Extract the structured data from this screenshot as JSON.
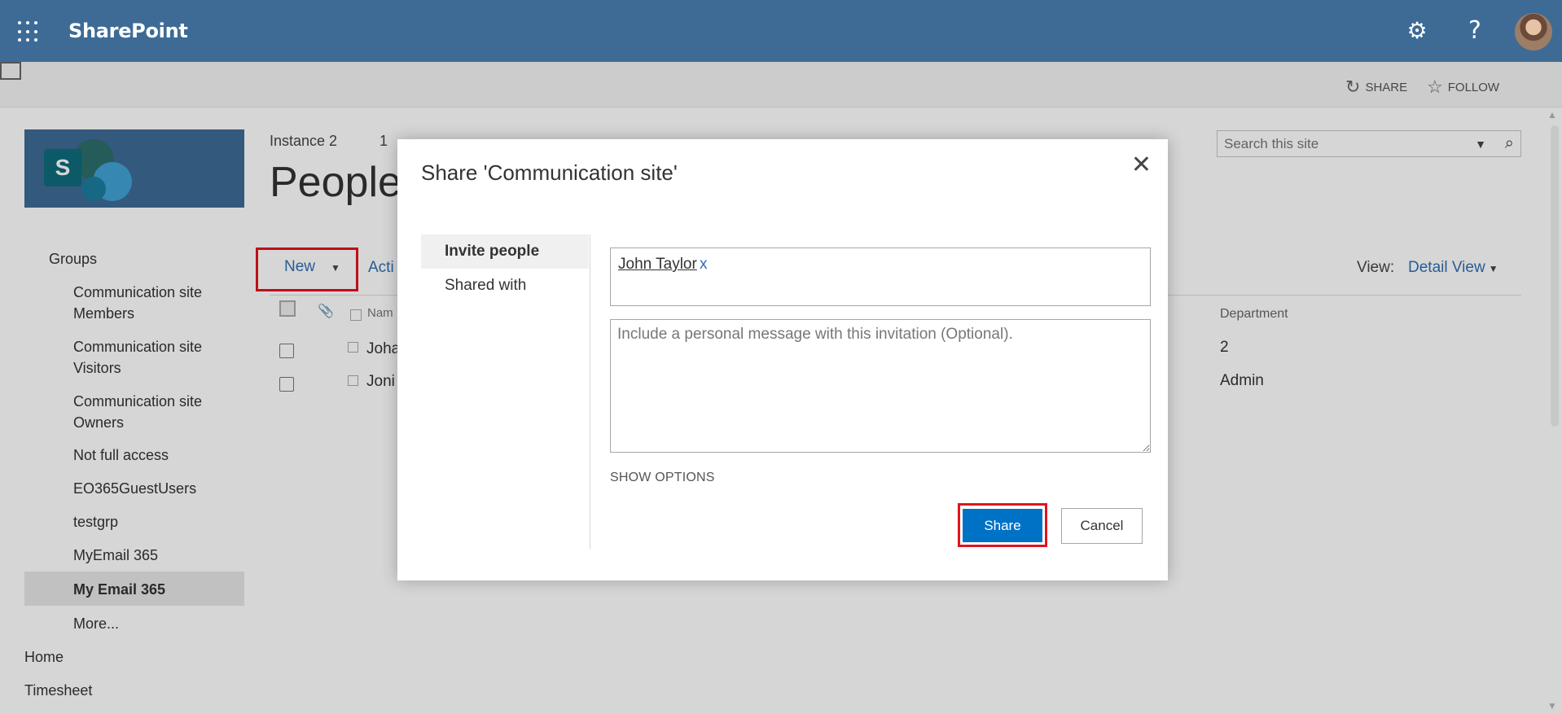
{
  "suite_bar": {
    "brand": "SharePoint",
    "icons": [
      "waffle-icon",
      "gear-icon",
      "help-icon",
      "avatar"
    ]
  },
  "ribbon": {
    "share_label": "SHARE",
    "follow_label": "FOLLOW"
  },
  "header": {
    "breadcrumb": "Instance 2",
    "breadcrumb_next": "1",
    "title": "People"
  },
  "search": {
    "placeholder": "Search this site"
  },
  "leftnav": {
    "groups_heading": "Groups",
    "items": [
      "Communication site Members",
      "Communication site Visitors",
      "Communication site Owners",
      "Not full access",
      "EO365GuestUsers",
      "testgrp",
      "MyEmail 365",
      "My Email 365",
      "More..."
    ],
    "selected": "My Email 365",
    "top_links": [
      "Home",
      "Timesheet"
    ]
  },
  "toolbar": {
    "new_label": "New",
    "actions_label": "Acti",
    "view_label": "View:",
    "view_value": "Detail View"
  },
  "list": {
    "columns": [
      "Nam",
      "Department"
    ],
    "rows": [
      {
        "name": "Joha",
        "department": "2"
      },
      {
        "name": "Joni",
        "department": "Admin"
      }
    ]
  },
  "dialog": {
    "title": "Share 'Communication site'",
    "close_glyph": "✕",
    "tabs": [
      "Invite people",
      "Shared with"
    ],
    "selected_tab": "Invite people",
    "invitee": "John Taylor",
    "invitee_remove": "x",
    "message_placeholder": "Include a personal message with this invitation (Optional).",
    "show_options": "SHOW OPTIONS",
    "share_button": "Share",
    "cancel_button": "Cancel"
  },
  "colors": {
    "suite_bar": "#3d6b96",
    "primary_button": "#0072c6",
    "highlight_box": "#e0141e",
    "link": "#2f6fb2"
  }
}
